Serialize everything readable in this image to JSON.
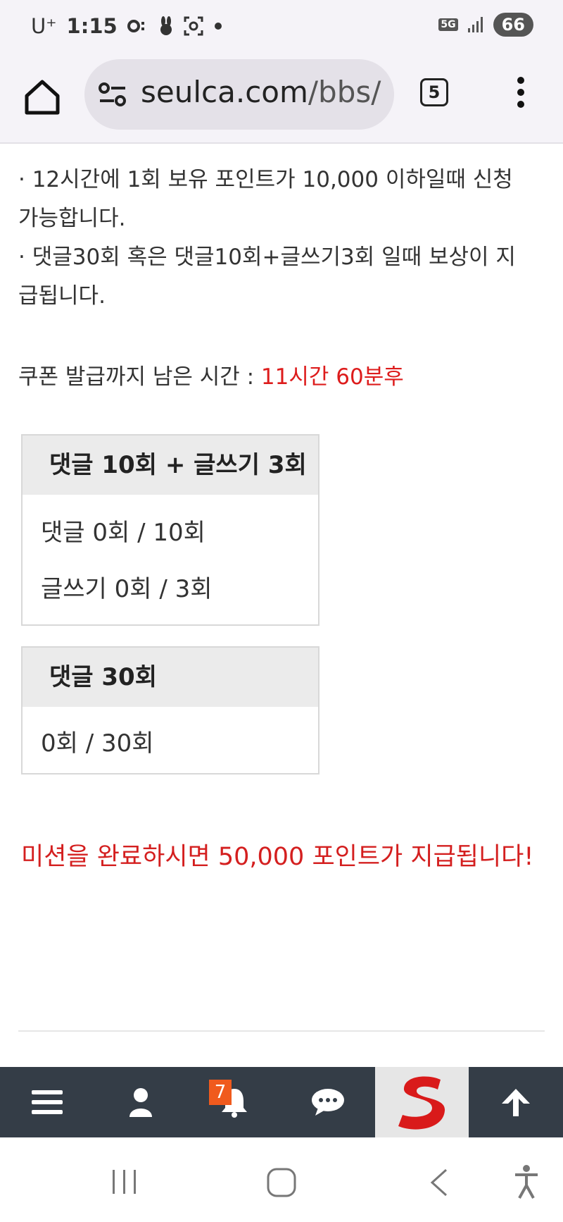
{
  "status_bar": {
    "carrier": "U⁺",
    "time": "1:15",
    "network": "5G",
    "battery": "66"
  },
  "browser": {
    "url_main": "seulca.com",
    "url_path": "/bbs/",
    "tab_count": "5"
  },
  "info": {
    "line1": "· 12시간에 1회 보유 포인트가 10,000 이하일때 신청",
    "line2": "가능합니다.",
    "line3": "· 댓글30회 혹은 댓글10회+글쓰기3회 일때 보상이 지",
    "line4": "급됩니다."
  },
  "remaining": {
    "label": "쿠폰 발급까지 남은 시간 : ",
    "value": "11시간 60분후"
  },
  "mission_a": {
    "title": "댓글 10회 + 글쓰기 3회",
    "comments": "댓글 0회 / 10회",
    "posts": "글쓰기 0회 / 3회"
  },
  "mission_b": {
    "title": "댓글 30회",
    "comments": "0회 / 30회"
  },
  "reward_text": "미션을 완료하시면 50,000 포인트가 지급됩니다!",
  "bottom_nav": {
    "notification_count": "7"
  },
  "colors": {
    "accent_red": "#dd1c1c",
    "nav_bg": "#343d47",
    "badge": "#f05a1d"
  }
}
